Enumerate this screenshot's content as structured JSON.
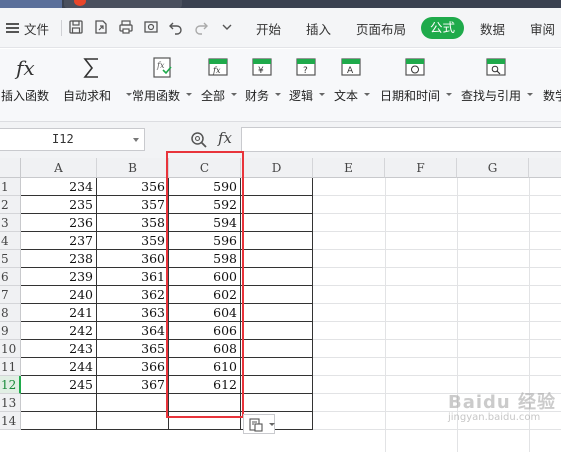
{
  "menubar": {
    "file_label": "文件",
    "tabs": [
      "开始",
      "插入",
      "页面布局",
      "公式",
      "数据",
      "审阅"
    ],
    "active_tab": "公式"
  },
  "ribbon": {
    "buttons": [
      "插入函数",
      "自动求和",
      "常用函数",
      "全部",
      "财务",
      "逻辑",
      "文本",
      "日期和时间",
      "查找与引用",
      "数学"
    ]
  },
  "formula_bar": {
    "name_box": "I12",
    "fx": "fx",
    "formula": ""
  },
  "sheet": {
    "columns": [
      "A",
      "B",
      "C",
      "D",
      "E",
      "F",
      "G"
    ],
    "row_numbers": [
      "1",
      "2",
      "3",
      "4",
      "5",
      "6",
      "7",
      "8",
      "9",
      "10",
      "11",
      "12",
      "13",
      "14"
    ],
    "selected_row": "12",
    "rows": [
      [
        "234",
        "356",
        "590"
      ],
      [
        "235",
        "357",
        "592"
      ],
      [
        "236",
        "358",
        "594"
      ],
      [
        "237",
        "359",
        "596"
      ],
      [
        "238",
        "360",
        "598"
      ],
      [
        "239",
        "361",
        "600"
      ],
      [
        "240",
        "362",
        "602"
      ],
      [
        "241",
        "363",
        "604"
      ],
      [
        "242",
        "364",
        "606"
      ],
      [
        "243",
        "365",
        "608"
      ],
      [
        "244",
        "366",
        "610"
      ],
      [
        "245",
        "367",
        "612"
      ]
    ]
  },
  "colors": {
    "accent_green": "#1faa4b",
    "highlight_red": "#e8343b"
  },
  "watermark": {
    "text": "Baidu 经验",
    "sub": "jingyan.baidu.com"
  }
}
